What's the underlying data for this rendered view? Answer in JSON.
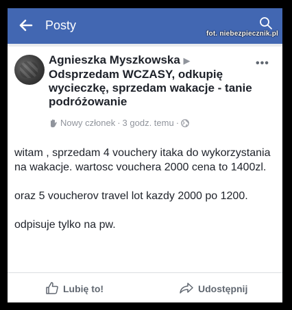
{
  "topbar": {
    "title": "Posty",
    "watermark": "fot. niebezpiecznik.pl"
  },
  "post": {
    "author": "Agnieszka Myszkowska",
    "group": "Odsprzedam WCZASY, odkupię wycieczkę, sprzedam wakacje - tanie podróżowanie",
    "member_badge": "Nowy członek",
    "time": "3 godz. temu",
    "separator": "·",
    "paragraphs": [
      "witam , sprzedam 4 vouchery itaka do wykorzystania na wakacje. wartosc vouchera 2000 cena to 1400zl.",
      "oraz 5 voucherov travel lot kazdy 2000 po 1200.",
      "odpisuje tylko na pw."
    ]
  },
  "actions": {
    "like": "Lubię to!",
    "share": "Udostępnij"
  },
  "colors": {
    "topbar": "#4267b2",
    "text": "#1d2129",
    "muted": "#90949c"
  }
}
